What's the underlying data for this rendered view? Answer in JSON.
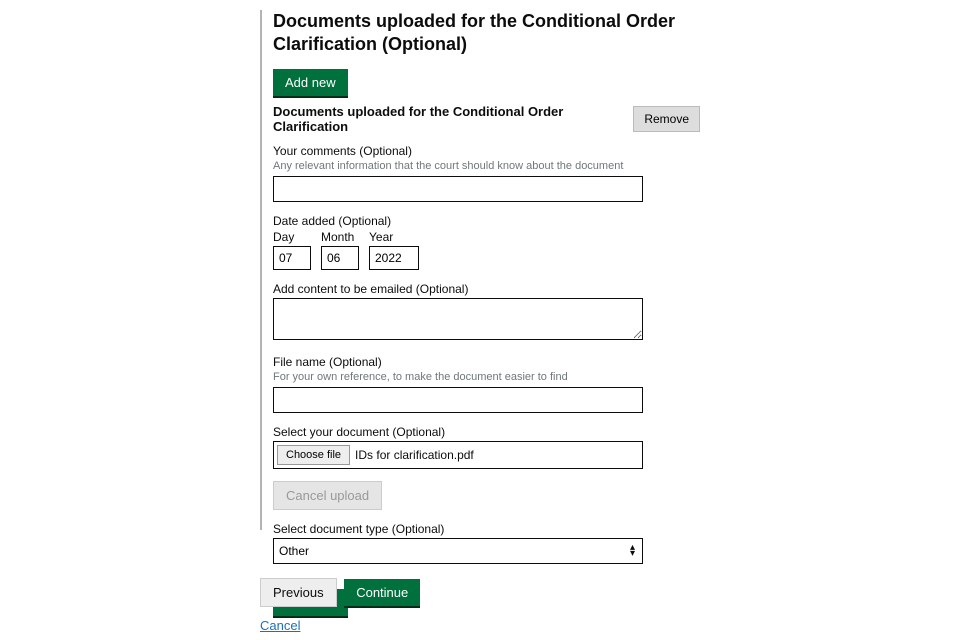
{
  "page": {
    "title": "Documents uploaded for the Conditional Order Clarification (Optional)"
  },
  "buttons": {
    "add_new_top": "Add new",
    "add_new_bottom": "Add new",
    "remove": "Remove",
    "choose_file": "Choose file",
    "cancel_upload": "Cancel upload",
    "previous": "Previous",
    "continue": "Continue",
    "cancel": "Cancel"
  },
  "entry": {
    "heading": "Documents uploaded for the Conditional Order Clarification",
    "comments": {
      "label": "Your comments (Optional)",
      "hint": "Any relevant information that the court should know about the document",
      "value": ""
    },
    "date_added": {
      "label": "Date added (Optional)",
      "day_label": "Day",
      "month_label": "Month",
      "year_label": "Year",
      "day": "07",
      "month": "06",
      "year": "2022"
    },
    "email_content": {
      "label": "Add content to be emailed (Optional)",
      "value": ""
    },
    "file_name_field": {
      "label": "File name (Optional)",
      "hint": "For your own reference, to make the document easier to find",
      "value": ""
    },
    "select_document": {
      "label": "Select your document (Optional)",
      "selected_file": "IDs for clarification.pdf"
    },
    "document_type": {
      "label": "Select document type (Optional)",
      "selected": "Other"
    }
  }
}
